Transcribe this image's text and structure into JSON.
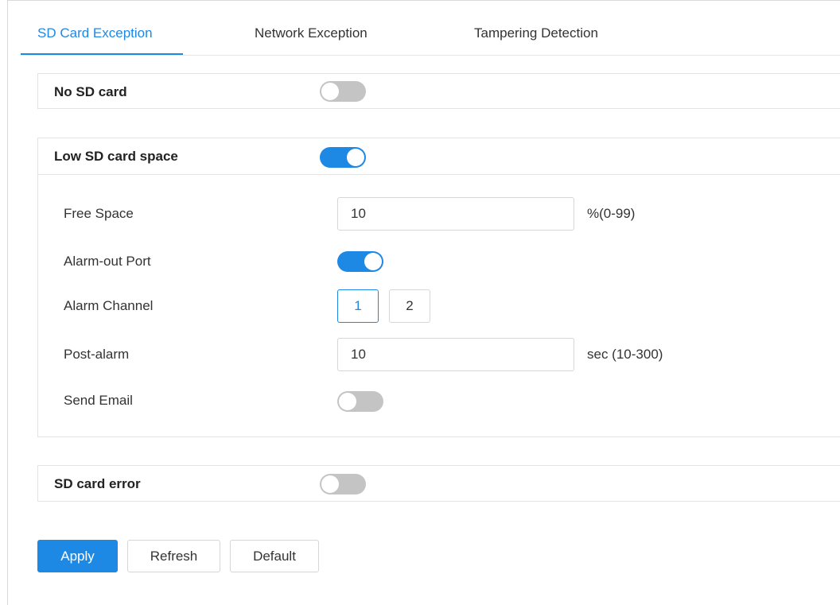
{
  "tabs": [
    {
      "label": "SD Card Exception",
      "active": true
    },
    {
      "label": "Network Exception",
      "active": false
    },
    {
      "label": "Tampering Detection",
      "active": false
    }
  ],
  "no_sd_card": {
    "title": "No SD card",
    "enabled": false
  },
  "low_space": {
    "title": "Low SD card space",
    "enabled": true,
    "free_space": {
      "label": "Free Space",
      "value": "10",
      "unit": "%(0-99)"
    },
    "alarm_out": {
      "label": "Alarm-out Port",
      "enabled": true
    },
    "alarm_channel": {
      "label": "Alarm Channel",
      "options": [
        "1",
        "2"
      ],
      "selected": "1"
    },
    "post_alarm": {
      "label": "Post-alarm",
      "value": "10",
      "unit": "sec (10-300)"
    },
    "send_email": {
      "label": "Send Email",
      "enabled": false
    }
  },
  "sd_error": {
    "title": "SD card error",
    "enabled": false
  },
  "buttons": {
    "apply": "Apply",
    "refresh": "Refresh",
    "default": "Default"
  },
  "colors": {
    "accent": "#1e88e5",
    "toggle_off": "#c4c4c4",
    "border": "#d6d6d6"
  }
}
